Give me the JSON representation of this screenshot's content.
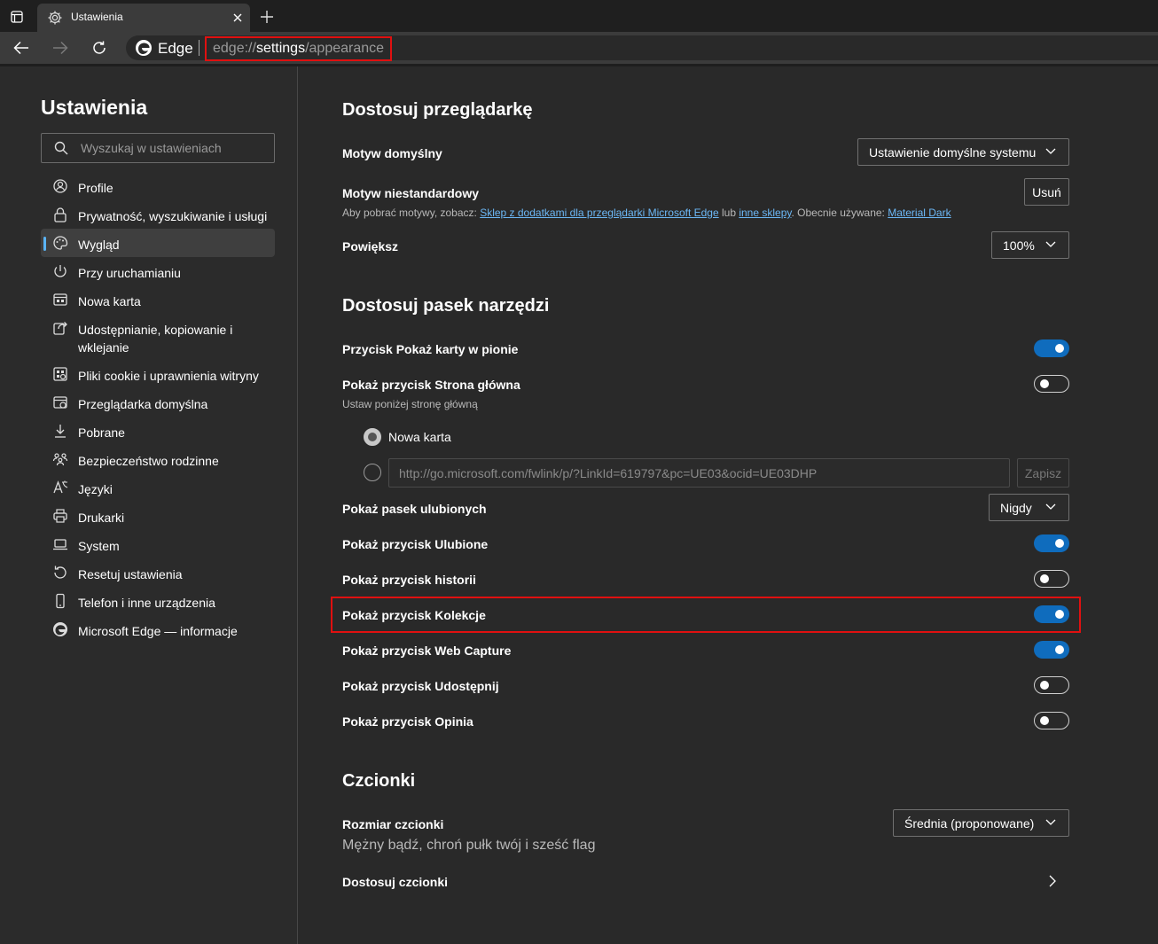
{
  "browser": {
    "tab_title": "Ustawienia",
    "brand": "Edge",
    "url_prefix": "edge://",
    "url_highlight": "settings",
    "url_suffix": "/appearance"
  },
  "sidebar": {
    "title": "Ustawienia",
    "search_placeholder": "Wyszukaj w ustawieniach",
    "items": [
      {
        "label": "Profile",
        "icon": "profile-icon"
      },
      {
        "label": "Prywatność, wyszukiwanie i usługi",
        "icon": "lock-icon"
      },
      {
        "label": "Wygląd",
        "icon": "palette-icon",
        "active": true
      },
      {
        "label": "Przy uruchamianiu",
        "icon": "power-icon"
      },
      {
        "label": "Nowa karta",
        "icon": "new-tab-icon"
      },
      {
        "label": "Udostępnianie, kopiowanie i wklejanie",
        "icon": "share-icon"
      },
      {
        "label": "Pliki cookie i uprawnienia witryny",
        "icon": "cookie-icon"
      },
      {
        "label": "Przeglądarka domyślna",
        "icon": "default-browser-icon"
      },
      {
        "label": "Pobrane",
        "icon": "download-icon"
      },
      {
        "label": "Bezpieczeństwo rodzinne",
        "icon": "family-icon"
      },
      {
        "label": "Języki",
        "icon": "language-icon"
      },
      {
        "label": "Drukarki",
        "icon": "printer-icon"
      },
      {
        "label": "System",
        "icon": "laptop-icon"
      },
      {
        "label": "Resetuj ustawienia",
        "icon": "reset-icon"
      },
      {
        "label": "Telefon i inne urządzenia",
        "icon": "phone-icon"
      },
      {
        "label": "Microsoft Edge — informacje",
        "icon": "edge-icon"
      }
    ]
  },
  "appearance": {
    "heading": "Dostosuj przeglądarkę",
    "theme_label": "Motyw domyślny",
    "theme_value": "Ustawienie domyślne systemu",
    "custom_theme_label": "Motyw niestandardowy",
    "custom_theme_button": "Usuń",
    "custom_theme_text1": "Aby pobrać motywy, zobacz: ",
    "custom_theme_link1": "Sklep z dodatkami dla przeglądarki Microsoft Edge",
    "custom_theme_text2": " lub ",
    "custom_theme_link2": "inne sklepy",
    "custom_theme_text3": ". Obecnie używane: ",
    "custom_theme_link3": "Material Dark",
    "zoom_label": "Powiększ",
    "zoom_value": "100%"
  },
  "toolbar_section": {
    "heading": "Dostosuj pasek narzędzi",
    "vertical_tabs_label": "Przycisk Pokaż karty w pionie",
    "vertical_tabs_on": true,
    "home_label": "Pokaż przycisk Strona główna",
    "home_on": false,
    "home_sub": "Ustaw poniżej stronę główną",
    "radio_new_tab": "Nowa karta",
    "home_url": "http://go.microsoft.com/fwlink/p/?LinkId=619797&pc=UE03&ocid=UE03DHP",
    "save_label": "Zapisz",
    "favorites_bar_label": "Pokaż pasek ulubionych",
    "favorites_bar_value": "Nigdy",
    "favorites_label": "Pokaż przycisk Ulubione",
    "favorites_on": true,
    "history_label": "Pokaż przycisk historii",
    "history_on": false,
    "collections_label": "Pokaż przycisk Kolekcje",
    "collections_on": true,
    "web_capture_label": "Pokaż przycisk Web Capture",
    "web_capture_on": true,
    "share_label": "Pokaż przycisk Udostępnij",
    "share_on": false,
    "feedback_label": "Pokaż przycisk Opinia",
    "feedback_on": false
  },
  "fonts": {
    "heading": "Czcionki",
    "size_label": "Rozmiar czcionki",
    "size_value": "Średnia (proponowane)",
    "sample": "Mężny bądź, chroń pułk twój i sześć flag",
    "customize_label": "Dostosuj czcionki"
  },
  "colors": {
    "accent": "#0f6cbd",
    "link": "#6cb8f6",
    "highlight_border": "#e01010",
    "background": "#292929"
  }
}
